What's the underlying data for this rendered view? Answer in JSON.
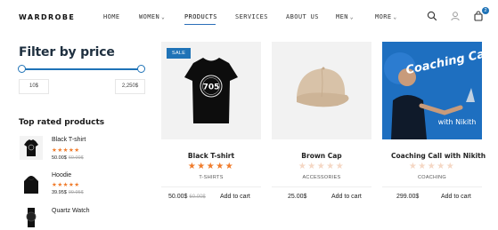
{
  "header": {
    "logo": "WARDROBE",
    "nav": [
      {
        "label": "HOME",
        "chevron": false,
        "active": false
      },
      {
        "label": "WOMEN",
        "chevron": true,
        "active": false
      },
      {
        "label": "PRODUCTS",
        "chevron": false,
        "active": true
      },
      {
        "label": "SERVICES",
        "chevron": false,
        "active": false
      },
      {
        "label": "ABOUT US",
        "chevron": false,
        "active": false
      },
      {
        "label": "MEN",
        "chevron": true,
        "active": false
      },
      {
        "label": "MORE",
        "chevron": true,
        "active": false
      }
    ],
    "icons": [
      "search-icon",
      "user-icon",
      "cart-icon"
    ],
    "cart_count": "2",
    "accent_color": "#1f73b7"
  },
  "sidebar": {
    "filter_title": "Filter by price",
    "price_min": "10$",
    "price_max": "2,250$",
    "top_rated_title": "Top rated products",
    "top_rated": [
      {
        "name": "Black T-shirt",
        "stars": 5,
        "price": "50.00$",
        "old_price": "60.00$"
      },
      {
        "name": "Hoodie",
        "stars": 5,
        "price": "39.95$",
        "old_price": "99.95$"
      },
      {
        "name": "Quartz Watch",
        "stars": 5,
        "price": "",
        "old_price": ""
      }
    ]
  },
  "products": [
    {
      "name": "Black T-shirt",
      "category": "T-SHIRTS",
      "price": "50.00$",
      "old_price": "60.00$",
      "add_label": "Add to cart",
      "stars": 5,
      "badge": "SALE",
      "image_text": "705"
    },
    {
      "name": "Brown Cap",
      "category": "ACCESSORIES",
      "price": "25.00$",
      "old_price": "",
      "add_label": "Add to cart",
      "stars": 0,
      "badge": "",
      "image_text": ""
    },
    {
      "name": "Coaching Call with Nikith",
      "category": "COACHING",
      "price": "299.00$",
      "old_price": "",
      "add_label": "Add to cart",
      "stars": 0,
      "badge": "",
      "image_text": "Coaching Call",
      "image_caption": "with Nikith"
    }
  ]
}
